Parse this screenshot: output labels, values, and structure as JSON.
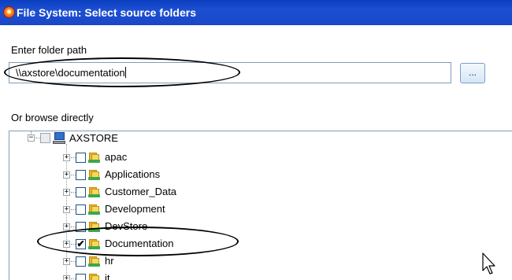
{
  "window": {
    "title": "File System: Select source folders",
    "icon": "app-icon"
  },
  "path_section": {
    "label": "Enter folder path",
    "value": "\\\\axstore\\documentation",
    "browse_button_label": "..."
  },
  "browse_section": {
    "label": "Or browse directly"
  },
  "tree": {
    "root": {
      "label": "AXSTORE",
      "expander": "−",
      "checked": false,
      "icon": "computer-icon"
    },
    "children": [
      {
        "label": "apac",
        "expander": "+",
        "checked": false,
        "icon": "shared-folder-icon"
      },
      {
        "label": "Applications",
        "expander": "+",
        "checked": false,
        "icon": "shared-folder-icon"
      },
      {
        "label": "Customer_Data",
        "expander": "+",
        "checked": false,
        "icon": "shared-folder-icon"
      },
      {
        "label": "Development",
        "expander": "+",
        "checked": false,
        "icon": "shared-folder-icon"
      },
      {
        "label": "DevStore",
        "expander": "+",
        "checked": false,
        "icon": "shared-folder-icon"
      },
      {
        "label": "Documentation",
        "expander": "+",
        "checked": true,
        "icon": "shared-folder-icon"
      },
      {
        "label": "hr",
        "expander": "+",
        "checked": false,
        "icon": "shared-folder-icon"
      },
      {
        "label": "it",
        "expander": "+",
        "checked": false,
        "icon": "shared-folder-icon"
      }
    ]
  },
  "colors": {
    "titlebar": "#1947c7",
    "input_border": "#7f9db9",
    "folder": "#f8d85a",
    "share_hand": "#3ba84a"
  }
}
